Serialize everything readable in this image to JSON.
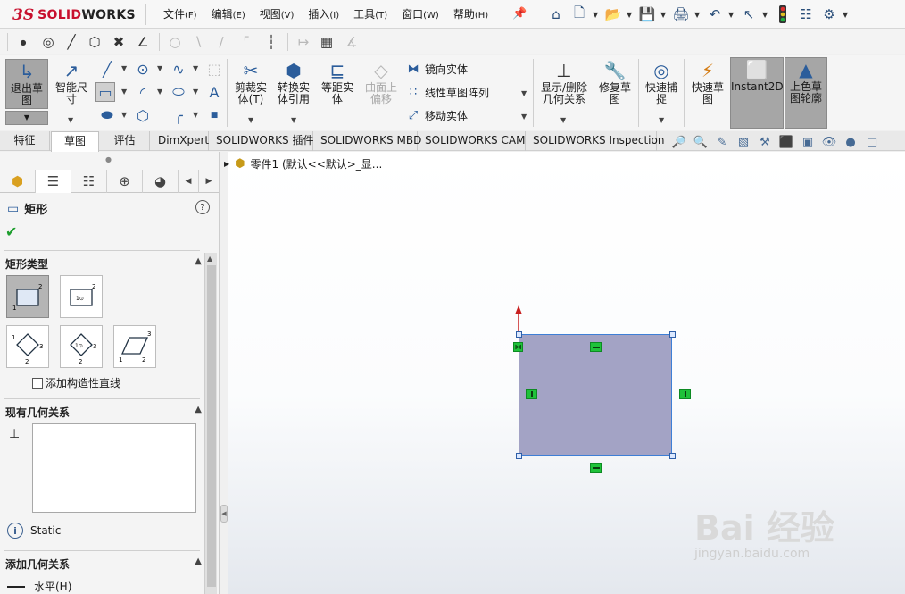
{
  "app": {
    "logo_mark": "3S",
    "logo_text": "SOLID",
    "logo_text2": "WORKS"
  },
  "menu": [
    {
      "label": "文件",
      "key": "(F)"
    },
    {
      "label": "编辑",
      "key": "(E)"
    },
    {
      "label": "视图",
      "key": "(V)"
    },
    {
      "label": "插入",
      "key": "(I)"
    },
    {
      "label": "工具",
      "key": "(T)"
    },
    {
      "label": "窗口",
      "key": "(W)"
    },
    {
      "label": "帮助",
      "key": "(H)"
    }
  ],
  "command_manager": {
    "exit_sketch": "退出草\n图",
    "smart_dim": "智能尺\n寸",
    "trim": "剪裁实\n体(T)",
    "convert": "转换实\n体引用",
    "offset": "等距实\n体",
    "surface_offset": "曲面上\n偏移",
    "mirror": "镜向实体",
    "linear_pattern": "线性草图阵列",
    "move": "移动实体",
    "show_relations": "显示/删除\n几何关系",
    "repair": "修复草\n图",
    "quick_snaps": "快速捕\n捉",
    "rapid_sketch": "快速草\n图",
    "instant2d": "Instant2D",
    "shaded_sketch": "上色草\n图轮廓"
  },
  "tabs": [
    "特征",
    "草图",
    "评估",
    "DimXpert",
    "SOLIDWORKS 插件",
    "SOLIDWORKS MBD",
    "SOLIDWORKS CAM",
    "SOLIDWORKS Inspection"
  ],
  "active_tab": "草图",
  "property_manager": {
    "title": "矩形",
    "help": "?",
    "group_rect_type": "矩形类型",
    "add_construction": "添加构造性直线",
    "group_existing": "现有几何关系",
    "status": "Static",
    "group_add": "添加几何关系",
    "horizontal": "水平(H)"
  },
  "tree": {
    "label": "零件1  (默认<<默认>_显..."
  },
  "watermark": {
    "text": "Bai 经验",
    "url": "jingyan.baidu.com"
  },
  "colors": {
    "rect_fill": "#a3a3c5",
    "rect_border": "#3e7fd6",
    "relation": "#1fc23a",
    "brand": "#c8102e"
  }
}
